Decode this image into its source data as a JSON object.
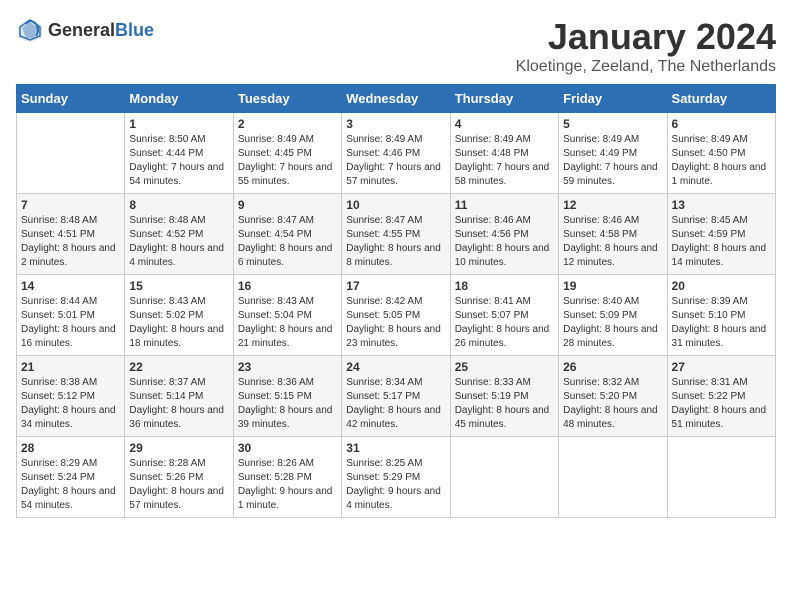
{
  "logo": {
    "general": "General",
    "blue": "Blue"
  },
  "title": "January 2024",
  "subtitle": "Kloetinge, Zeeland, The Netherlands",
  "days_of_week": [
    "Sunday",
    "Monday",
    "Tuesday",
    "Wednesday",
    "Thursday",
    "Friday",
    "Saturday"
  ],
  "weeks": [
    [
      {
        "day": "",
        "sunrise": "",
        "sunset": "",
        "daylight": ""
      },
      {
        "day": "1",
        "sunrise": "Sunrise: 8:50 AM",
        "sunset": "Sunset: 4:44 PM",
        "daylight": "Daylight: 7 hours and 54 minutes."
      },
      {
        "day": "2",
        "sunrise": "Sunrise: 8:49 AM",
        "sunset": "Sunset: 4:45 PM",
        "daylight": "Daylight: 7 hours and 55 minutes."
      },
      {
        "day": "3",
        "sunrise": "Sunrise: 8:49 AM",
        "sunset": "Sunset: 4:46 PM",
        "daylight": "Daylight: 7 hours and 57 minutes."
      },
      {
        "day": "4",
        "sunrise": "Sunrise: 8:49 AM",
        "sunset": "Sunset: 4:48 PM",
        "daylight": "Daylight: 7 hours and 58 minutes."
      },
      {
        "day": "5",
        "sunrise": "Sunrise: 8:49 AM",
        "sunset": "Sunset: 4:49 PM",
        "daylight": "Daylight: 7 hours and 59 minutes."
      },
      {
        "day": "6",
        "sunrise": "Sunrise: 8:49 AM",
        "sunset": "Sunset: 4:50 PM",
        "daylight": "Daylight: 8 hours and 1 minute."
      }
    ],
    [
      {
        "day": "7",
        "sunrise": "Sunrise: 8:48 AM",
        "sunset": "Sunset: 4:51 PM",
        "daylight": "Daylight: 8 hours and 2 minutes."
      },
      {
        "day": "8",
        "sunrise": "Sunrise: 8:48 AM",
        "sunset": "Sunset: 4:52 PM",
        "daylight": "Daylight: 8 hours and 4 minutes."
      },
      {
        "day": "9",
        "sunrise": "Sunrise: 8:47 AM",
        "sunset": "Sunset: 4:54 PM",
        "daylight": "Daylight: 8 hours and 6 minutes."
      },
      {
        "day": "10",
        "sunrise": "Sunrise: 8:47 AM",
        "sunset": "Sunset: 4:55 PM",
        "daylight": "Daylight: 8 hours and 8 minutes."
      },
      {
        "day": "11",
        "sunrise": "Sunrise: 8:46 AM",
        "sunset": "Sunset: 4:56 PM",
        "daylight": "Daylight: 8 hours and 10 minutes."
      },
      {
        "day": "12",
        "sunrise": "Sunrise: 8:46 AM",
        "sunset": "Sunset: 4:58 PM",
        "daylight": "Daylight: 8 hours and 12 minutes."
      },
      {
        "day": "13",
        "sunrise": "Sunrise: 8:45 AM",
        "sunset": "Sunset: 4:59 PM",
        "daylight": "Daylight: 8 hours and 14 minutes."
      }
    ],
    [
      {
        "day": "14",
        "sunrise": "Sunrise: 8:44 AM",
        "sunset": "Sunset: 5:01 PM",
        "daylight": "Daylight: 8 hours and 16 minutes."
      },
      {
        "day": "15",
        "sunrise": "Sunrise: 8:43 AM",
        "sunset": "Sunset: 5:02 PM",
        "daylight": "Daylight: 8 hours and 18 minutes."
      },
      {
        "day": "16",
        "sunrise": "Sunrise: 8:43 AM",
        "sunset": "Sunset: 5:04 PM",
        "daylight": "Daylight: 8 hours and 21 minutes."
      },
      {
        "day": "17",
        "sunrise": "Sunrise: 8:42 AM",
        "sunset": "Sunset: 5:05 PM",
        "daylight": "Daylight: 8 hours and 23 minutes."
      },
      {
        "day": "18",
        "sunrise": "Sunrise: 8:41 AM",
        "sunset": "Sunset: 5:07 PM",
        "daylight": "Daylight: 8 hours and 26 minutes."
      },
      {
        "day": "19",
        "sunrise": "Sunrise: 8:40 AM",
        "sunset": "Sunset: 5:09 PM",
        "daylight": "Daylight: 8 hours and 28 minutes."
      },
      {
        "day": "20",
        "sunrise": "Sunrise: 8:39 AM",
        "sunset": "Sunset: 5:10 PM",
        "daylight": "Daylight: 8 hours and 31 minutes."
      }
    ],
    [
      {
        "day": "21",
        "sunrise": "Sunrise: 8:38 AM",
        "sunset": "Sunset: 5:12 PM",
        "daylight": "Daylight: 8 hours and 34 minutes."
      },
      {
        "day": "22",
        "sunrise": "Sunrise: 8:37 AM",
        "sunset": "Sunset: 5:14 PM",
        "daylight": "Daylight: 8 hours and 36 minutes."
      },
      {
        "day": "23",
        "sunrise": "Sunrise: 8:36 AM",
        "sunset": "Sunset: 5:15 PM",
        "daylight": "Daylight: 8 hours and 39 minutes."
      },
      {
        "day": "24",
        "sunrise": "Sunrise: 8:34 AM",
        "sunset": "Sunset: 5:17 PM",
        "daylight": "Daylight: 8 hours and 42 minutes."
      },
      {
        "day": "25",
        "sunrise": "Sunrise: 8:33 AM",
        "sunset": "Sunset: 5:19 PM",
        "daylight": "Daylight: 8 hours and 45 minutes."
      },
      {
        "day": "26",
        "sunrise": "Sunrise: 8:32 AM",
        "sunset": "Sunset: 5:20 PM",
        "daylight": "Daylight: 8 hours and 48 minutes."
      },
      {
        "day": "27",
        "sunrise": "Sunrise: 8:31 AM",
        "sunset": "Sunset: 5:22 PM",
        "daylight": "Daylight: 8 hours and 51 minutes."
      }
    ],
    [
      {
        "day": "28",
        "sunrise": "Sunrise: 8:29 AM",
        "sunset": "Sunset: 5:24 PM",
        "daylight": "Daylight: 8 hours and 54 minutes."
      },
      {
        "day": "29",
        "sunrise": "Sunrise: 8:28 AM",
        "sunset": "Sunset: 5:26 PM",
        "daylight": "Daylight: 8 hours and 57 minutes."
      },
      {
        "day": "30",
        "sunrise": "Sunrise: 8:26 AM",
        "sunset": "Sunset: 5:28 PM",
        "daylight": "Daylight: 9 hours and 1 minute."
      },
      {
        "day": "31",
        "sunrise": "Sunrise: 8:25 AM",
        "sunset": "Sunset: 5:29 PM",
        "daylight": "Daylight: 9 hours and 4 minutes."
      },
      {
        "day": "",
        "sunrise": "",
        "sunset": "",
        "daylight": ""
      },
      {
        "day": "",
        "sunrise": "",
        "sunset": "",
        "daylight": ""
      },
      {
        "day": "",
        "sunrise": "",
        "sunset": "",
        "daylight": ""
      }
    ]
  ]
}
